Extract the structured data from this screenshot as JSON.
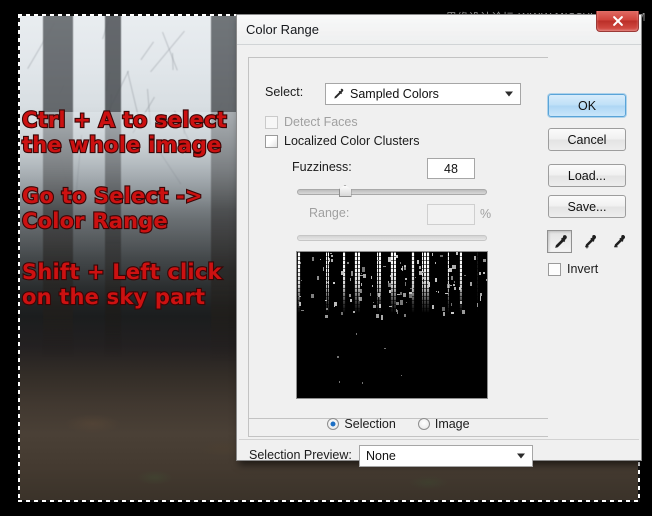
{
  "watermark": "思缘设计论坛 WWW.MISSYUAN.COM",
  "annotations": [
    {
      "lines": [
        "Ctrl + A to select",
        "the whole image"
      ]
    },
    {
      "lines": [
        "Go to Select ->",
        "Color Range"
      ]
    },
    {
      "lines": [
        "Shift + Left click",
        "on the sky part"
      ]
    }
  ],
  "dialog": {
    "title": "Color Range",
    "close_label": "Close",
    "select": {
      "label": "Select:",
      "value": "Sampled Colors",
      "icon": "eyedropper-icon"
    },
    "detect_faces": {
      "label": "Detect Faces",
      "checked": false,
      "enabled": false
    },
    "localized_color_clusters": {
      "label": "Localized Color Clusters",
      "checked": false,
      "enabled": true
    },
    "fuzziness": {
      "label": "Fuzziness:",
      "value": "48",
      "slider_percent": 25
    },
    "range": {
      "label": "Range:",
      "value": "",
      "unit": "%",
      "enabled": false,
      "slider_percent": 0
    },
    "preview_mode": {
      "selection": {
        "label": "Selection",
        "selected": true
      },
      "image": {
        "label": "Image",
        "selected": false
      }
    },
    "selection_preview": {
      "label": "Selection Preview:",
      "value": "None"
    },
    "buttons": {
      "ok": "OK",
      "cancel": "Cancel",
      "load": "Load...",
      "save": "Save..."
    },
    "eyedropper_tools": [
      {
        "name": "eyedropper-icon",
        "active": true
      },
      {
        "name": "eyedropper-add-icon",
        "active": false
      },
      {
        "name": "eyedropper-subtract-icon",
        "active": false
      }
    ],
    "invert": {
      "label": "Invert",
      "checked": false
    }
  },
  "colors": {
    "accent": "#1d6fc4",
    "annotation_red": "#cc1111",
    "dialog_bg": "#f0f0f0",
    "close_red": "#d0443c"
  }
}
